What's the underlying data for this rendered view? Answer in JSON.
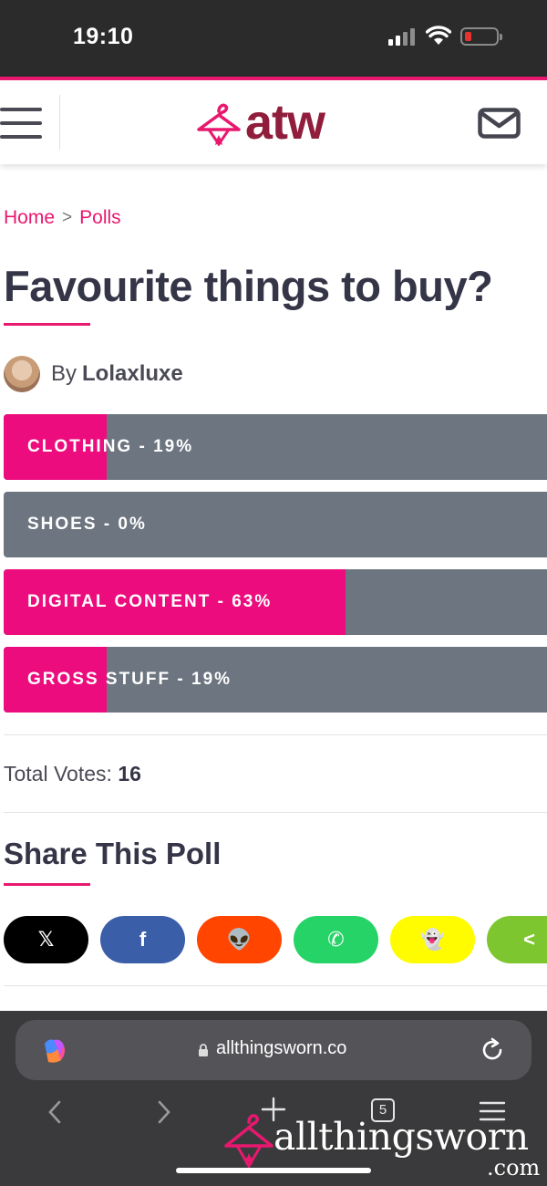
{
  "status_bar": {
    "time": "19:10"
  },
  "header": {
    "logo_text": "atw"
  },
  "breadcrumb": {
    "home": "Home",
    "separator": ">",
    "current": "Polls"
  },
  "page": {
    "title": "Favourite things to buy?",
    "author_prefix": "By",
    "author_name": "Lolaxluxe"
  },
  "poll": {
    "options": [
      {
        "label": "CLOTHING - 19%",
        "percent": 19
      },
      {
        "label": "SHOES - 0%",
        "percent": 0
      },
      {
        "label": "DIGITAL CONTENT - 63%",
        "percent": 63
      },
      {
        "label": "GROSS STUFF - 19%",
        "percent": 19
      }
    ],
    "total_votes_label": "Total Votes:",
    "total_votes": "16"
  },
  "share": {
    "title": "Share This Poll",
    "buttons": [
      {
        "name": "x",
        "icon": "x-icon",
        "glyph": "𝕏",
        "color": "#000000",
        "text_color": "#ffffff"
      },
      {
        "name": "facebook",
        "icon": "facebook-icon",
        "glyph": "f",
        "color": "#3b5ea8",
        "text_color": "#ffffff"
      },
      {
        "name": "reddit",
        "icon": "reddit-icon",
        "glyph": "👽",
        "color": "#ff4500",
        "text_color": "#ffffff"
      },
      {
        "name": "whatsapp",
        "icon": "whatsapp-icon",
        "glyph": "✆",
        "color": "#25d366",
        "text_color": "#ffffff"
      },
      {
        "name": "snapchat",
        "icon": "snapchat-icon",
        "glyph": "👻",
        "color": "#fffc00",
        "text_color": "#ffffff"
      },
      {
        "name": "share",
        "icon": "share-icon",
        "glyph": "<",
        "color": "#7dc62f",
        "text_color": "#ffffff"
      }
    ]
  },
  "browser": {
    "url": "allthingsworn.co",
    "tab_count": "5"
  },
  "watermark": {
    "text": "allthingsworn",
    "suffix": ".com"
  },
  "colors": {
    "accent": "#e8186f",
    "poll_fill": "#ec0c7e",
    "poll_track": "#6c7580",
    "brand_dark": "#8f1d3b",
    "heading": "#353548"
  }
}
